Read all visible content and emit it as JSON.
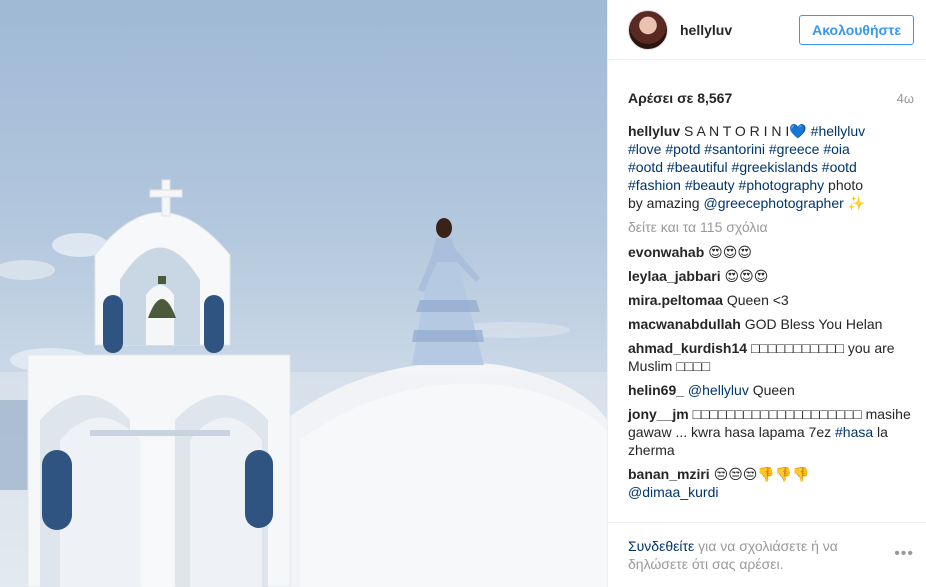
{
  "header": {
    "username": "hellyluv",
    "follow_label": "Ακολουθήστε"
  },
  "post": {
    "likes": "Αρέσει σε 8,567",
    "time": "4ω",
    "caption": {
      "user": "hellyluv",
      "text": "S A N T O R I N I",
      "heart_emoji": "💙",
      "tags_line1": "#hellyluv",
      "line2": "#love #potd #santorini #greece #oia",
      "line3": "#ootd #beautiful #greekislands #ootd",
      "line4_tags": "#fashion #beauty #photography",
      "line4_text": " photo",
      "line5_text": "by amazing ",
      "mention": "@greecephotographer",
      "sparkle": "✨"
    },
    "view_all": "δείτε και τα 115 σχόλια"
  },
  "comments": [
    {
      "user": "evonwahab",
      "text": "😍😍😍"
    },
    {
      "user": "leylaa_jabbari",
      "text": "😍😍😍"
    },
    {
      "user": "mira.peltomaa",
      "text": "Queen <3"
    },
    {
      "user": "macwanabdullah",
      "text": "GOD Bless You Helan"
    },
    {
      "user": "ahmad_kurdish14",
      "text": "□□□□□□□□□□□ you are Muslim □□□□"
    },
    {
      "user": "helin69_",
      "mention": "@hellyluv",
      "text": " Queen"
    },
    {
      "user": "jony__jm",
      "text": "□□□□□□□□□□□□□□□□□□□□ masihe gawaw ... kwra hasa lapama 7ez ",
      "tag": "#hasa",
      "text_after": " la zherma"
    },
    {
      "user": "banan_mziri",
      "text": "😒😒😒👎👎👎",
      "mention2": "@dimaa_kurdi"
    }
  ],
  "footer": {
    "login_link": "Συνδεθείτε",
    "text": " για να σχολιάσετε ή να δηλώσετε ότι σας αρέσει.",
    "more_icon": "•••"
  }
}
